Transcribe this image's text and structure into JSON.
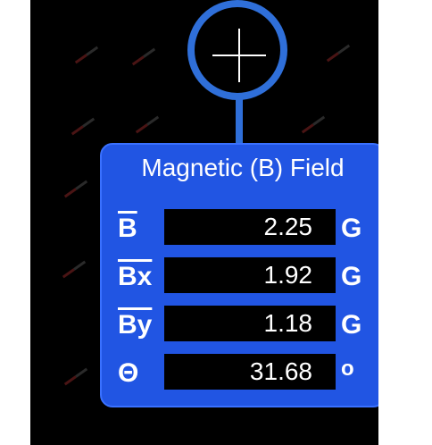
{
  "panel": {
    "title": "Magnetic (B) Field",
    "rows": [
      {
        "symbol": "B",
        "value": "2.25",
        "unit": "G"
      },
      {
        "symbol": "Bx",
        "value": "1.92",
        "unit": "G"
      },
      {
        "symbol": "By",
        "value": "1.18",
        "unit": "G"
      },
      {
        "symbol": "Θ",
        "value": "31.68",
        "unit": "o"
      }
    ]
  },
  "colors": {
    "panel": "#2155e3",
    "probe": "#2f6fd9",
    "background": "#000000"
  }
}
